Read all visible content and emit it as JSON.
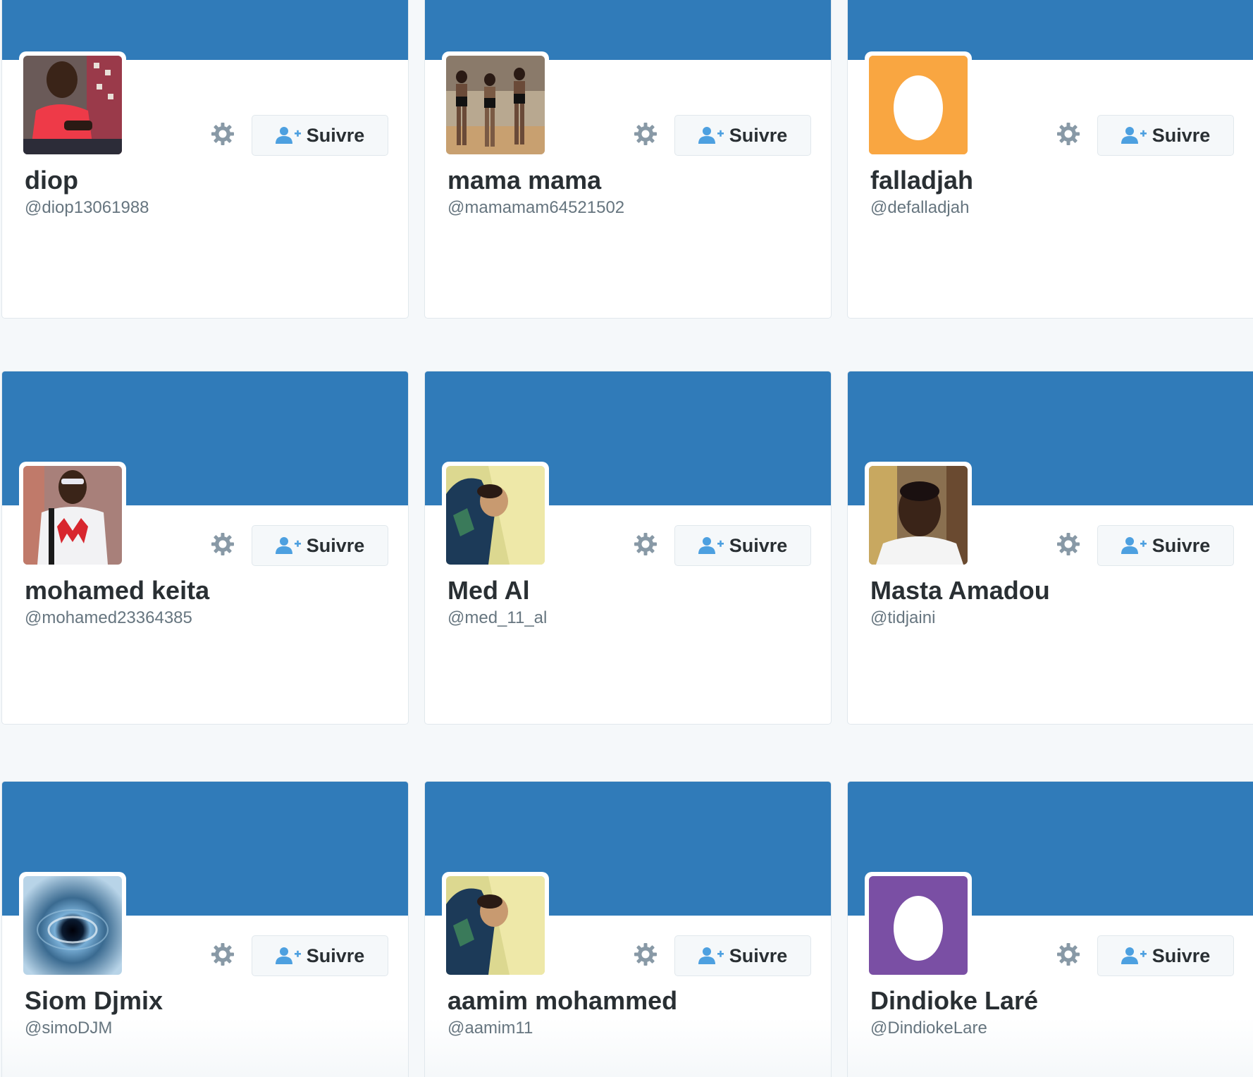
{
  "follow_label": "Suivre",
  "colors": {
    "banner": "#307bb9",
    "egg_orange": "#f9a641",
    "egg_purple": "#7a4fa4",
    "follow_icon": "#4da0e0"
  },
  "cards": [
    {
      "name": "diop",
      "handle": "@diop13061988",
      "avatar": "photo-red-shirt-man"
    },
    {
      "name": "mama mama",
      "handle": "@mamamam64521502",
      "avatar": "photo-group-women"
    },
    {
      "name": "falladjah",
      "handle": "@defalladjah",
      "avatar": "default-egg-orange"
    },
    {
      "name": "mohamed keita",
      "handle": "@mohamed23364385",
      "avatar": "photo-man-white-shirt"
    },
    {
      "name": "Med Al",
      "handle": "@med_11_al",
      "avatar": "photo-child-hoodie"
    },
    {
      "name": "Masta Amadou",
      "handle": "@tidjaini",
      "avatar": "photo-man-portrait"
    },
    {
      "name": "Siom Djmix",
      "handle": "@simoDJM",
      "avatar": "photo-space-vortex"
    },
    {
      "name": "aamim mohammed",
      "handle": "@aamim11",
      "avatar": "photo-child-hoodie"
    },
    {
      "name": "Dindioke Laré",
      "handle": "@DindiokeLare",
      "avatar": "default-egg-purple"
    }
  ]
}
